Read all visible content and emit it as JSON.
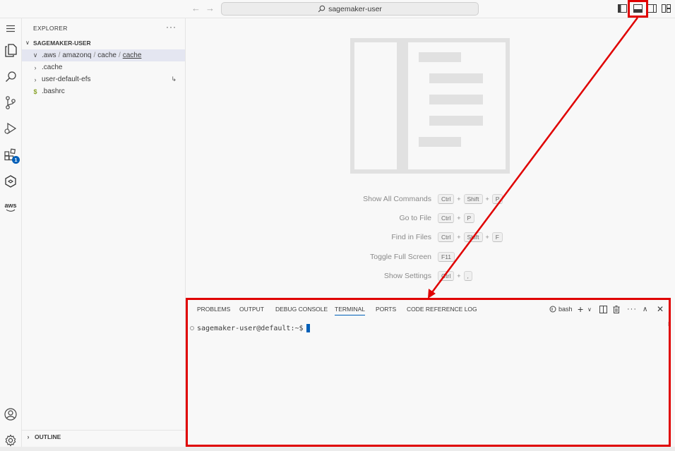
{
  "titlebar": {
    "search_text": "sagemaker-user",
    "back_icon": "arrow-left-icon",
    "forward_icon": "arrow-right-icon"
  },
  "activity_bar": {
    "items": [
      "menu-icon",
      "explorer-icon",
      "search-icon",
      "source-control-icon",
      "run-debug-icon",
      "extensions-icon",
      "amazon-q-icon",
      "aws-icon"
    ],
    "extensions_badge": "1",
    "aws_label": "aws"
  },
  "sidebar": {
    "header": "EXPLORER",
    "more": "···",
    "workspace": "SAGEMAKER-USER",
    "tree": [
      {
        "parts": [
          ".aws",
          "amazonq",
          "cache",
          "cache"
        ],
        "sep": "/"
      },
      {
        "label": ".cache"
      },
      {
        "label": "user-default-efs"
      },
      {
        "label": ".bashrc",
        "prefix": "$"
      }
    ],
    "outline": "OUTLINE"
  },
  "editor": {
    "shortcuts": [
      {
        "label": "Show All Commands",
        "keys": [
          "Ctrl",
          "Shift",
          "P"
        ]
      },
      {
        "label": "Go to File",
        "keys": [
          "Ctrl",
          "P"
        ]
      },
      {
        "label": "Find in Files",
        "keys": [
          "Ctrl",
          "Shift",
          "F"
        ]
      },
      {
        "label": "Toggle Full Screen",
        "keys": [
          "F11"
        ]
      },
      {
        "label": "Show Settings",
        "keys": [
          "Ctrl",
          ","
        ]
      }
    ]
  },
  "panel": {
    "tabs": [
      "PROBLEMS",
      "OUTPUT",
      "DEBUG CONSOLE",
      "TERMINAL",
      "PORTS",
      "CODE REFERENCE LOG"
    ],
    "active_tab": "TERMINAL",
    "shell": "bash",
    "more": "···",
    "prompt": "sagemaker-user@default:~$"
  },
  "colors": {
    "accent": "#005fb8",
    "annotation": "#e00000"
  }
}
